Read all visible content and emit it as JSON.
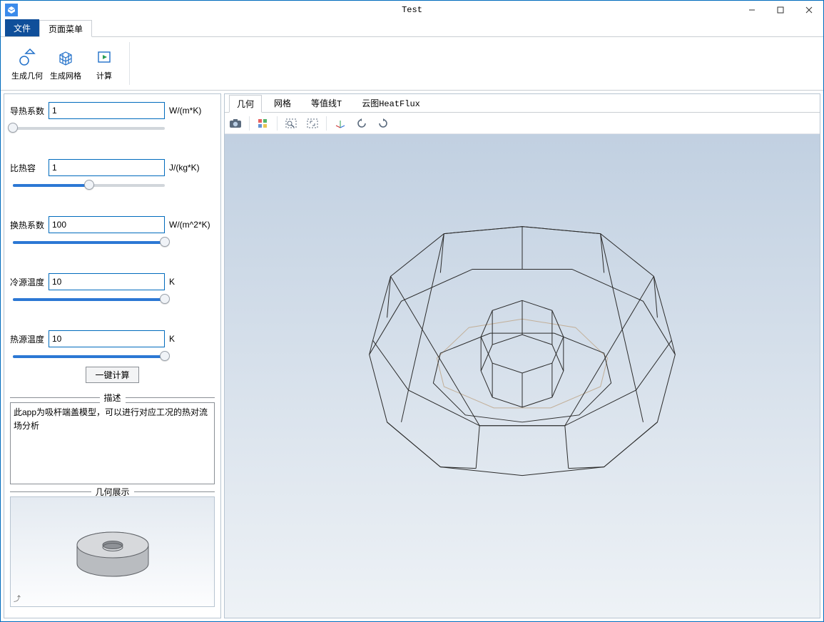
{
  "window": {
    "title": "Test"
  },
  "menus": {
    "file": "文件",
    "page": "页面菜单"
  },
  "ribbon": {
    "gen_geom": "生成几何",
    "gen_mesh": "生成网格",
    "compute": "计算"
  },
  "params": {
    "thermal_conductivity": {
      "label": "导热系数",
      "value": "1",
      "unit": "W/(m*K)",
      "pct": 0
    },
    "specific_heat": {
      "label": "比热容",
      "value": "1",
      "unit": "J/(kg*K)",
      "pct": 50
    },
    "heat_transfer_coef": {
      "label": "换热系数",
      "value": "100",
      "unit": "W/(m^2*K)",
      "pct": 100
    },
    "cold_temp": {
      "label": "冷源温度",
      "value": "10",
      "unit": "K",
      "pct": 100
    },
    "hot_temp": {
      "label": "热源温度",
      "value": "10",
      "unit": "K",
      "pct": 100
    }
  },
  "compute_button": "一键计算",
  "desc": {
    "legend": "描述",
    "text": "此app为吸杆端盖模型，可以进行对应工况的热对流场分析"
  },
  "geom": {
    "legend": "几何展示"
  },
  "view_tabs": {
    "geom": "几何",
    "mesh": "网格",
    "isoline": "等值线T",
    "heatflux": "云图HeatFlux"
  }
}
